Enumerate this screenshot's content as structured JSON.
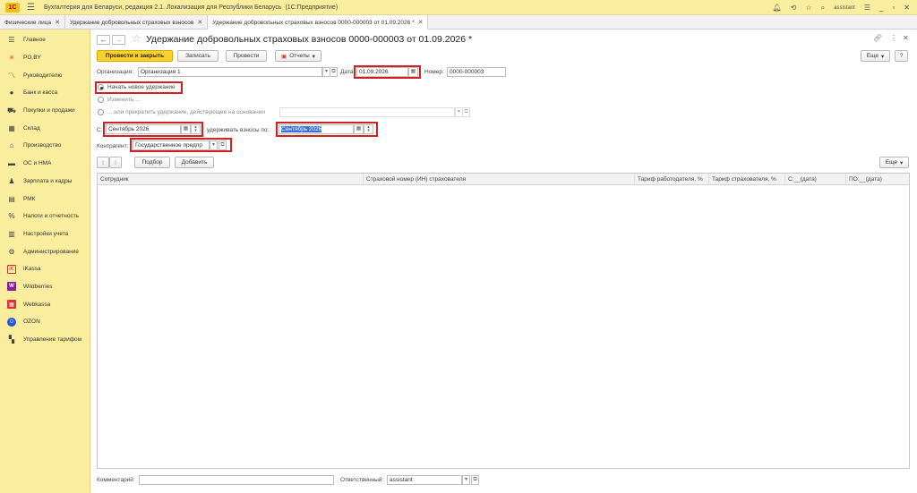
{
  "titlebar": {
    "logo": "1С",
    "title": "Бухгалтерия для Беларуси, редакция 2.1. Локализация для Республики Беларусь",
    "subtitle": "(1С:Предприятие)",
    "user": "assistant"
  },
  "tabs": [
    {
      "label": "Физические лица",
      "active": false
    },
    {
      "label": "Удержание добровольных страховых взносов",
      "active": false
    },
    {
      "label": "Удержание добровольных страховых взносов 0000-000003 от 01.09.2026 *",
      "active": true
    }
  ],
  "sidebar": {
    "items": [
      {
        "label": "Главное",
        "icon": "menu-icon"
      },
      {
        "label": "PO.BY",
        "icon": "sun-icon"
      },
      {
        "label": "Руководителю",
        "icon": "chart-icon"
      },
      {
        "label": "Банк и касса",
        "icon": "coin-icon"
      },
      {
        "label": "Покупки и продажи",
        "icon": "cart-icon"
      },
      {
        "label": "Склад",
        "icon": "warehouse-icon"
      },
      {
        "label": "Производство",
        "icon": "factory-icon"
      },
      {
        "label": "ОС и НМА",
        "icon": "truck-icon"
      },
      {
        "label": "Зарплата и кадры",
        "icon": "person-icon"
      },
      {
        "label": "РМК",
        "icon": "register-icon"
      },
      {
        "label": "Налоги и отчетность",
        "icon": "percent-icon"
      },
      {
        "label": "Настройки учета",
        "icon": "settings-doc-icon"
      },
      {
        "label": "Администрирование",
        "icon": "gear-icon"
      },
      {
        "label": "iKassa",
        "icon": "ikassa-icon"
      },
      {
        "label": "Wildberries",
        "icon": "wildberries-icon"
      },
      {
        "label": "Webkassa",
        "icon": "webkassa-icon"
      },
      {
        "label": "OZON",
        "icon": "ozon-icon"
      },
      {
        "label": "Управление тарифом",
        "icon": "tariff-icon"
      }
    ]
  },
  "doc": {
    "title": "Удержание добровольных страховых взносов 0000-000003 от 01.09.2026 *",
    "toolbar": {
      "post_close": "Провести и закрыть",
      "save": "Записать",
      "post": "Провести",
      "reports": "Отчеты",
      "more": "Еще",
      "help": "?"
    },
    "org_label": "Организация:",
    "org_value": "Организация 1",
    "date_label": "Дата:",
    "date_value": "01.09.2026",
    "number_label": "Номер:",
    "number_value": "0000-000003",
    "radio_new": "Начать новое удержание",
    "radio_change": "Изменить ...",
    "radio_stop": "... или прекратить удержание, действующее на основании",
    "from_label": "С:",
    "from_value": "Сентябрь 2026",
    "withhold_label": "удерживать взносы по:",
    "withhold_value": "Сентябрь 2026",
    "contractor_label": "Контрагент:",
    "contractor_value": "Государственное предпр",
    "table_toolbar": {
      "pick": "Подбор",
      "add": "Добавить",
      "more": "Еще"
    },
    "columns": [
      "Сотрудник",
      "Страховой номер (ИН) страхователя",
      "Тариф работодателя, %",
      "Тариф страхователя, %",
      "С:__(дата)",
      "ПО:__(дата)"
    ],
    "comment_label": "Комментарий:",
    "comment_value": "",
    "responsible_label": "Ответственный:",
    "responsible_value": "assistant"
  }
}
